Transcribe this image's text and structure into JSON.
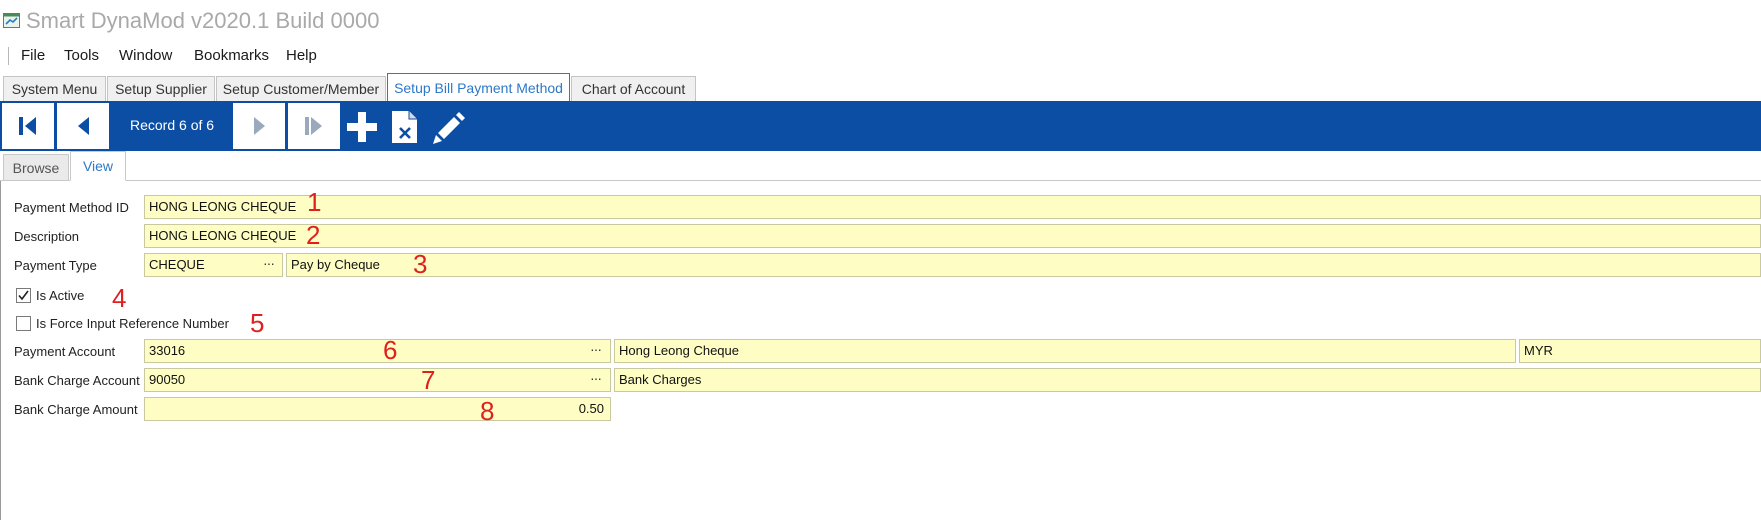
{
  "app": {
    "title": "Smart DynaMod v2020.1 Build 0000"
  },
  "menu": [
    "File",
    "Tools",
    "Window",
    "Bookmarks",
    "Help"
  ],
  "doc_tabs": [
    "System Menu",
    "Setup Supplier",
    "Setup Customer/Member",
    "Setup Bill Payment Method",
    "Chart of Account"
  ],
  "active_doc_tab": "Setup Bill Payment Method",
  "navigator": {
    "record_text": "Record 6 of 6"
  },
  "sub_tabs": [
    "Browse",
    "View"
  ],
  "active_sub_tab": "View",
  "form": {
    "payment_method_id": {
      "label": "Payment Method ID",
      "value": "HONG LEONG CHEQUE"
    },
    "description": {
      "label": "Description",
      "value": "HONG LEONG CHEQUE"
    },
    "payment_type": {
      "label": "Payment Type",
      "code": "CHEQUE",
      "name": "Pay by Cheque"
    },
    "is_active": {
      "label": "Is Active",
      "checked": true
    },
    "is_force_ref": {
      "label": "Is Force Input Reference Number",
      "checked": false
    },
    "payment_account": {
      "label": "Payment Account",
      "code": "33016",
      "name": "Hong Leong Cheque",
      "currency": "MYR"
    },
    "bank_charge_account": {
      "label": "Bank Charge Account",
      "code": "90050",
      "name": "Bank Charges"
    },
    "bank_charge_amount": {
      "label": "Bank Charge Amount",
      "value": "0.50"
    },
    "ellipsis": "···"
  },
  "annotations": [
    "1",
    "2",
    "3",
    "4",
    "5",
    "6",
    "7",
    "8"
  ],
  "colors": {
    "toolbar": "#0c4ea3",
    "field_bg": "#fefec4",
    "active_tab_text": "#2d78c8",
    "annotation": "#e02020"
  }
}
